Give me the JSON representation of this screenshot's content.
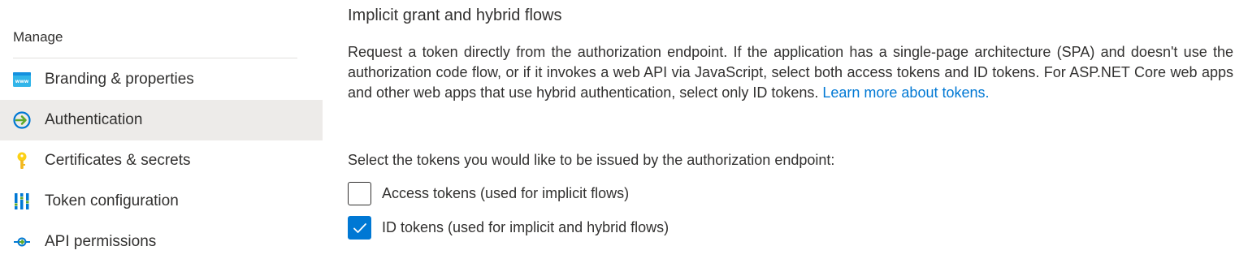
{
  "sidebar": {
    "section_title": "Manage",
    "items": [
      {
        "label": "Branding & properties",
        "icon": "branding-icon",
        "active": false
      },
      {
        "label": "Authentication",
        "icon": "authentication-icon",
        "active": true
      },
      {
        "label": "Certificates & secrets",
        "icon": "key-icon",
        "active": false
      },
      {
        "label": "Token configuration",
        "icon": "token-config-icon",
        "active": false
      },
      {
        "label": "API permissions",
        "icon": "api-permissions-icon",
        "active": false
      }
    ]
  },
  "main": {
    "heading": "Implicit grant and hybrid flows",
    "description": "Request a token directly from the authorization endpoint. If the application has a single-page architecture (SPA) and doesn't use the authorization code flow, or if it invokes a web API via JavaScript, select both access tokens and ID tokens. For ASP.NET Core web apps and other web apps that use hybrid authentication, select only ID tokens.",
    "learn_more_link": "Learn more about tokens.",
    "prompt": "Select the tokens you would like to be issued by the authorization endpoint:",
    "options": [
      {
        "label": "Access tokens (used for implicit flows)",
        "checked": false
      },
      {
        "label": "ID tokens (used for implicit and hybrid flows)",
        "checked": true
      }
    ]
  },
  "colors": {
    "accent": "#0078d4",
    "active_background": "#edebe9"
  }
}
